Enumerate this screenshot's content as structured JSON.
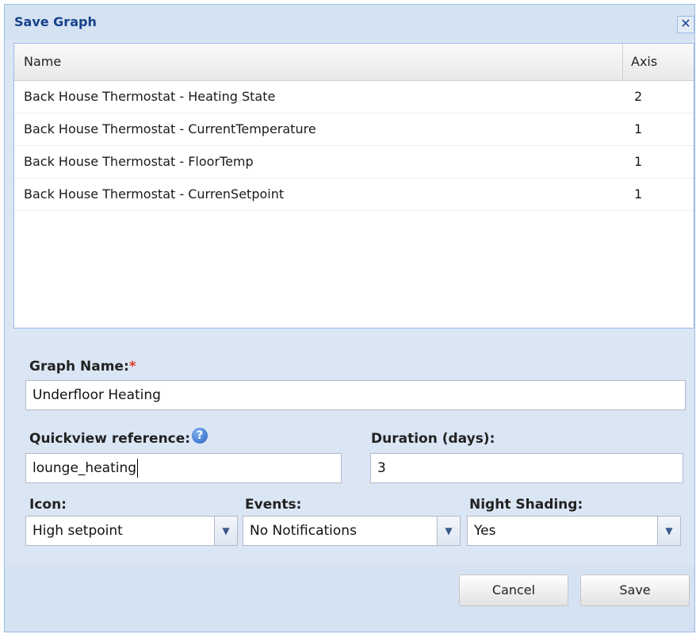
{
  "window": {
    "title": "Save Graph",
    "close_glyph": "✕"
  },
  "grid": {
    "columns": {
      "name": "Name",
      "axis": "Axis"
    },
    "rows": [
      {
        "name": "Back House Thermostat - Heating State",
        "axis": "2"
      },
      {
        "name": "Back House Thermostat - CurrentTemperature",
        "axis": "1"
      },
      {
        "name": "Back House Thermostat - FloorTemp",
        "axis": "1"
      },
      {
        "name": "Back House Thermostat - CurrenSetpoint",
        "axis": "1"
      }
    ]
  },
  "form": {
    "graph_name_label": "Graph Name:",
    "required_mark": "*",
    "graph_name_value": "Underfloor Heating",
    "quickview_label": "Quickview reference:",
    "help_glyph": "?",
    "quickview_value": "lounge_heating",
    "duration_label": "Duration (days):",
    "duration_value": "3",
    "icon_label": "Icon:",
    "icon_value": "High setpoint",
    "events_label": "Events:",
    "events_value": "No Notifications",
    "night_label": "Night Shading:",
    "night_value": "Yes",
    "dropdown_glyph": "▼"
  },
  "buttons": {
    "cancel": "Cancel",
    "save": "Save"
  },
  "colors": {
    "title": "#15428b",
    "border": "#99bbe8",
    "required": "#e03b2a",
    "help": "#2a64c5"
  }
}
